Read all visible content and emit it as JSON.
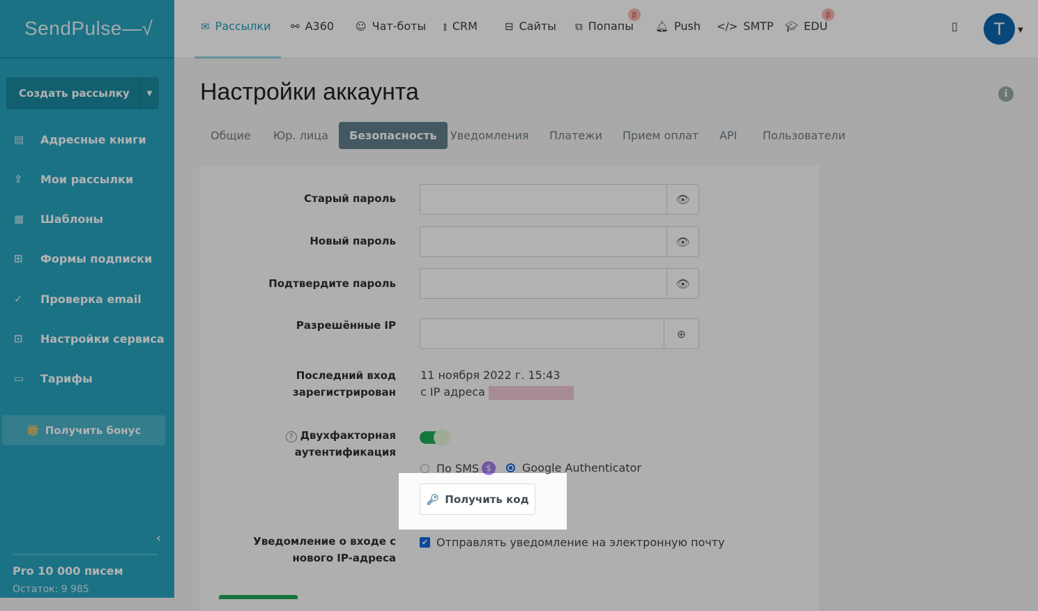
{
  "logo": "SendPulse",
  "sidebar": {
    "create": "Создать рассылку",
    "items": [
      {
        "label": "Адресные книги",
        "icon": "address-book-icon"
      },
      {
        "label": "Мои рассылки",
        "icon": "campaigns-icon"
      },
      {
        "label": "Шаблоны",
        "icon": "templates-icon"
      },
      {
        "label": "Формы подписки",
        "icon": "forms-icon"
      },
      {
        "label": "Проверка email",
        "icon": "verify-icon"
      },
      {
        "label": "Настройки сервиса",
        "icon": "settings-icon"
      },
      {
        "label": "Тарифы",
        "icon": "pricing-icon"
      }
    ],
    "bonus": "Получить бонус",
    "plan": "Pro 10 000 писем",
    "rest": "Остаток: 9 985"
  },
  "nav": [
    {
      "label": "Рассылки"
    },
    {
      "label": "A360"
    },
    {
      "label": "Чат-боты"
    },
    {
      "label": "CRM"
    },
    {
      "label": "Сайты"
    },
    {
      "label": "Попапы",
      "beta": "β"
    },
    {
      "label": "Push"
    },
    {
      "label": "SMTP"
    },
    {
      "label": "EDU",
      "beta": "β"
    }
  ],
  "avatar": "T",
  "page": {
    "title": "Настройки аккаунта",
    "tabs": [
      "Общие",
      "Юр. лица",
      "Безопасность",
      "Уведомления",
      "Платежи",
      "Прием оплат",
      "API",
      "Пользователи"
    ],
    "active_tab": "Безопасность"
  },
  "form": {
    "old_password": "Старый пароль",
    "new_password": "Новый пароль",
    "confirm_password": "Подтвердите пароль",
    "allowed_ip": "Разрешённые IP",
    "last_login_label": "Последний вход зарегистрирован",
    "last_login_date": "11 ноября 2022 г. 15:43",
    "last_login_ip_prefix": "с IP адреса",
    "twofa_label": "Двухфакторная аутентификация",
    "twofa_enabled": true,
    "sms": "По SMS",
    "sms_badge": "$",
    "google": "Google Authenticator",
    "method": "Google Authenticator",
    "get_code": "Получить код",
    "notify_label": "Уведомление о входе с нового IP-адреса",
    "notify_text": "Отправлять уведомление на электронную почту",
    "notify_checked": true
  }
}
